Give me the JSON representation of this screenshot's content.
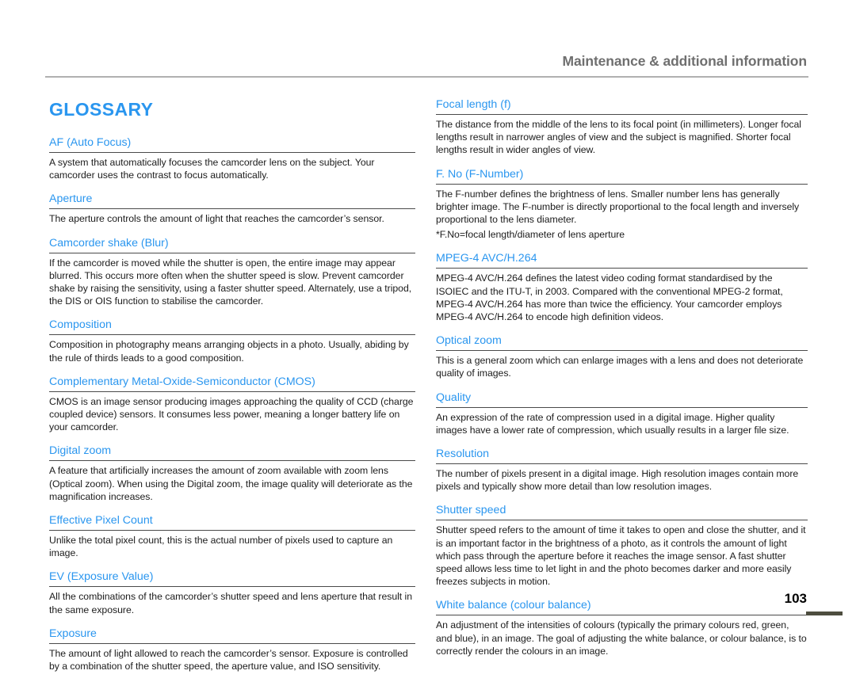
{
  "header": {
    "running_title": "Maintenance & additional information"
  },
  "title": "GLOSSARY",
  "page_number": "103",
  "colors": {
    "heading_blue": "#2a96ef",
    "running_header_gray": "#6f6f6f",
    "body_text": "#1c1c1c",
    "rule_gray": "#b0b0b0",
    "term_rule": "#4a4a4a",
    "page_bar": "#4d4d3f"
  },
  "left_column": [
    {
      "term": "AF (Auto Focus)",
      "definition": "A system that automatically focuses the camcorder lens on the subject. Your camcorder uses the contrast to focus automatically."
    },
    {
      "term": "Aperture",
      "definition": "The aperture controls the amount of light that reaches the camcorder’s sensor."
    },
    {
      "term": "Camcorder shake (Blur)",
      "definition": "If the camcorder is moved while the shutter is open, the entire image may appear blurred. This occurs more often when the shutter speed is slow. Prevent camcorder shake by raising the sensitivity, using a faster shutter speed. Alternately, use a tripod, the DIS or OIS function to stabilise the camcorder."
    },
    {
      "term": "Composition",
      "definition": "Composition in photography means arranging objects in a photo. Usually, abiding by the rule of thirds leads to a good composition."
    },
    {
      "term": "Complementary Metal-Oxide-Semiconductor (CMOS)",
      "definition": "CMOS is an image sensor producing images approaching the quality of CCD (charge coupled device) sensors. It consumes less power, meaning a longer battery life on your camcorder."
    },
    {
      "term": "Digital zoom",
      "definition": "A feature that artificially increases the amount of zoom available with zoom lens (Optical zoom). When using the Digital zoom, the image quality will deteriorate as the magnification increases."
    },
    {
      "term": "Effective Pixel Count",
      "definition": "Unlike the total pixel count, this is the actual number of pixels used to capture an image."
    },
    {
      "term": "EV (Exposure Value)",
      "definition": "All the combinations of the camcorder’s shutter speed and lens aperture that result in the same exposure."
    },
    {
      "term": "Exposure",
      "definition": "The amount of light allowed to reach the camcorder’s sensor. Exposure is controlled by a combination of the shutter speed, the aperture value, and ISO sensitivity."
    }
  ],
  "right_column": [
    {
      "term": "Focal length (f)",
      "definition": "The distance from the middle of the lens to its focal point (in millimeters). Longer focal lengths result in narrower angles of view and the subject is magnified. Shorter focal lengths result in wider angles of view."
    },
    {
      "term": "F. No (F-Number)",
      "definition": "The F-number defines the brightness of lens. Smaller number lens has generally brighter image. The F-number is directly proportional to the focal length and inversely proportional to the lens diameter.",
      "note": "*F.No=focal length/diameter of lens aperture"
    },
    {
      "term": "MPEG-4 AVC/H.264",
      "definition": "MPEG-4 AVC/H.264 defines the latest video coding format standardised by the ISOIEC and the ITU-T, in 2003. Compared with the conventional MPEG-2 format, MPEG-4 AVC/H.264 has more than twice the efficiency. Your camcorder employs MPEG-4 AVC/H.264 to encode high definition videos."
    },
    {
      "term": "Optical zoom",
      "definition": "This is a general zoom which can enlarge images with a lens and does not deteriorate quality of images."
    },
    {
      "term": "Quality",
      "definition": "An expression of the rate of compression used in a digital image. Higher quality images have a lower rate of compression, which usually results in a larger file size."
    },
    {
      "term": "Resolution",
      "definition": "The number of pixels present in a digital image. High resolution images contain more pixels and typically show more detail than low resolution images."
    },
    {
      "term": "Shutter speed",
      "definition": "Shutter speed refers to the amount of time it takes to open and close the shutter, and it is an important factor in the brightness of a photo, as it controls the amount of light which pass through the aperture before it reaches the image sensor. A fast shutter speed allows less time to let light in and the photo becomes darker and more easily freezes subjects in motion."
    },
    {
      "term": "White balance (colour balance)",
      "definition": "An adjustment of the intensities of colours (typically the primary colours red, green, and blue), in an image. The goal of adjusting the white balance, or colour balance, is to correctly render the colours in an image."
    }
  ]
}
